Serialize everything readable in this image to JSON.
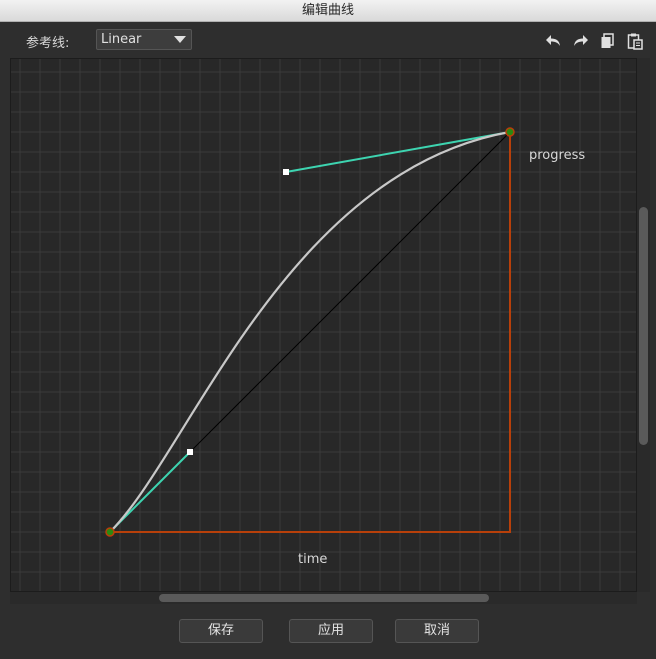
{
  "window": {
    "title": "编辑曲线"
  },
  "toolbar": {
    "reference_label": "参考线:",
    "reference_value": "Linear",
    "icons": [
      "undo-icon",
      "redo-icon",
      "copy-icon",
      "paste-icon"
    ]
  },
  "canvas": {
    "x_label": "time",
    "y_label": "progress"
  },
  "curve": {
    "start": [
      0,
      0
    ],
    "end": [
      1,
      1
    ],
    "control_point_1": [
      0.2,
      0.2
    ],
    "control_point_2": [
      0.44,
      0.9
    ]
  },
  "buttons": {
    "save": "保存",
    "apply": "应用",
    "cancel": "取消"
  },
  "colors": {
    "curve": "#c8c8c8",
    "handle": "#3dd4b0",
    "axis": "#b8400a",
    "endpoint": "#2a8a10",
    "linear_ref": "#000000",
    "grid_major": "#3a3a3a",
    "grid_minor": "#323232"
  }
}
